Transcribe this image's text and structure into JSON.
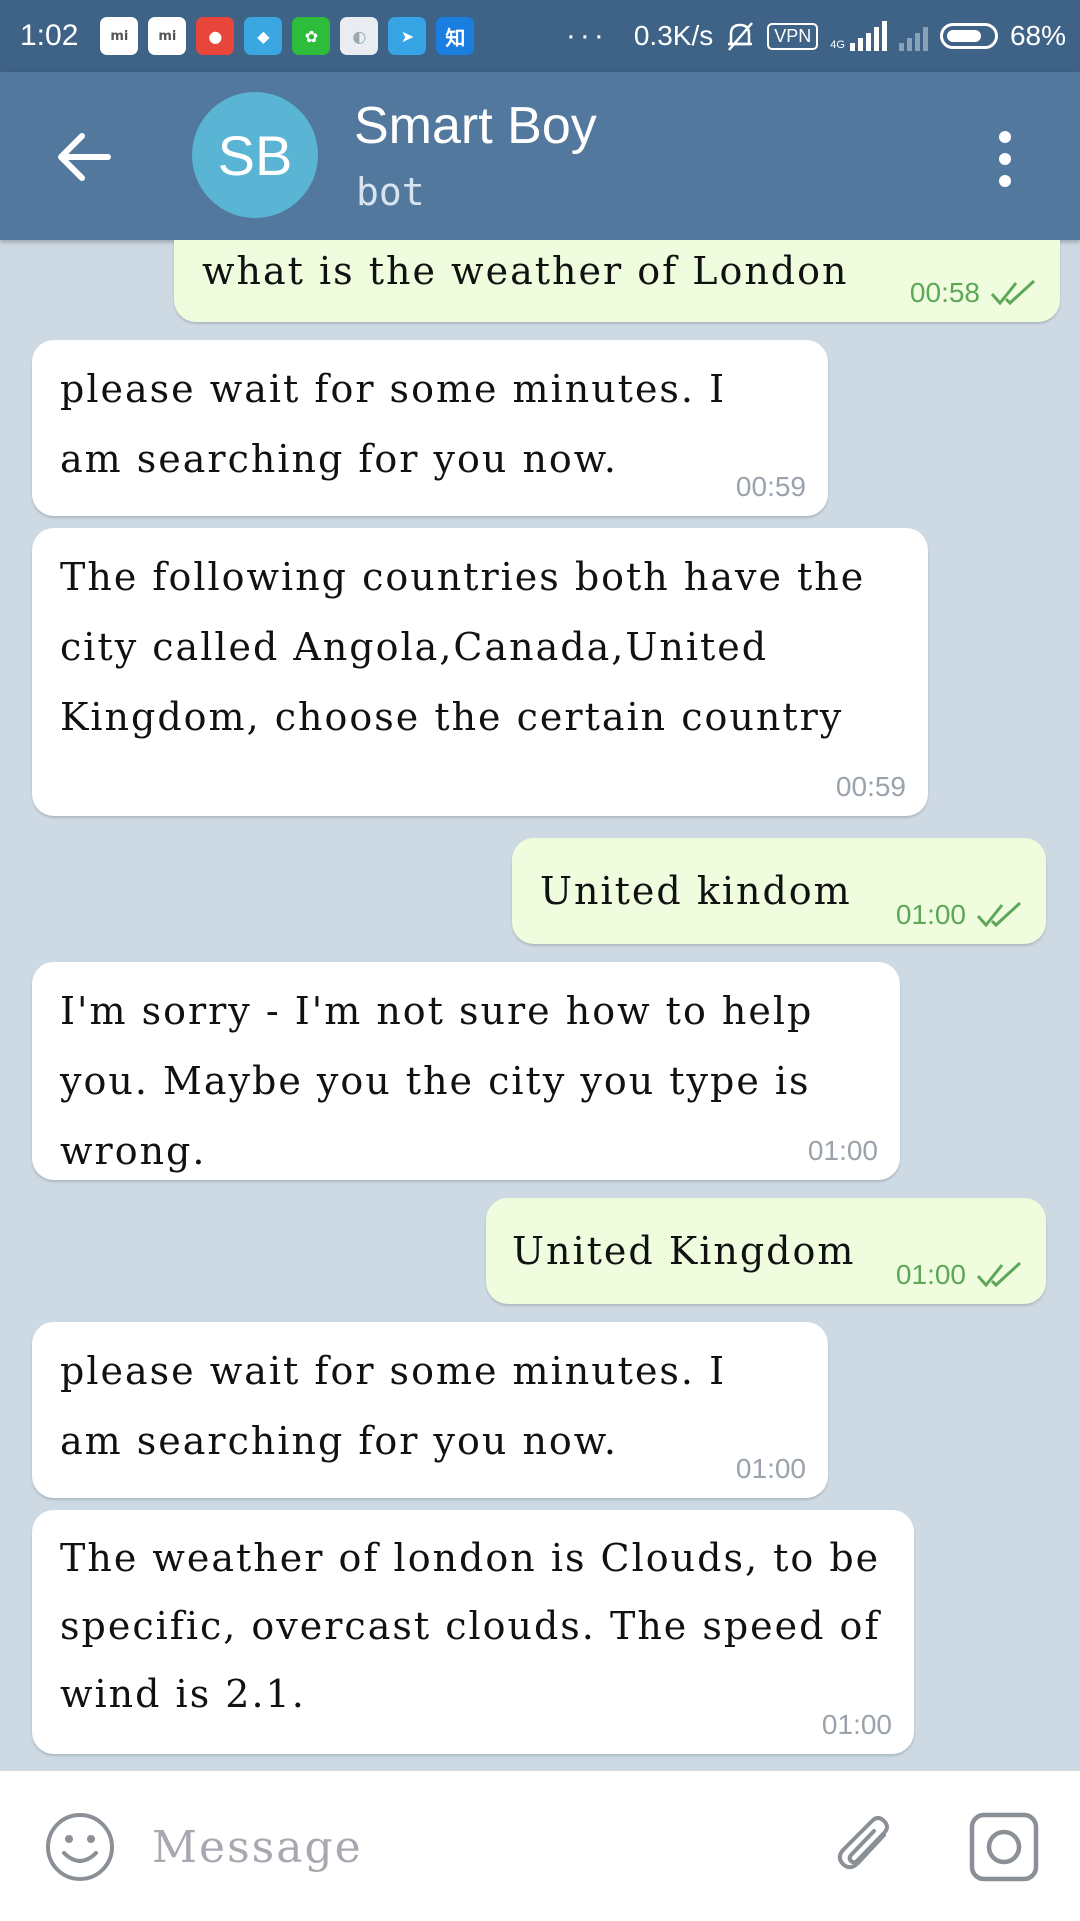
{
  "status_bar": {
    "time": "1:02",
    "notification_icons": [
      {
        "name": "mi-store-icon",
        "color": "#ffffff"
      },
      {
        "name": "mi-store-icon",
        "color": "#ffffff"
      },
      {
        "name": "cat-app-icon",
        "color": "#e8463b"
      },
      {
        "name": "comic-app-icon",
        "color": "#3aa7e0"
      },
      {
        "name": "soccer-app-icon",
        "color": "#2ebd3a"
      },
      {
        "name": "sync-app-icon",
        "color": "#e9edf2"
      },
      {
        "name": "telegram-app-icon",
        "color": "#37a4e6"
      },
      {
        "name": "zhihu-app-icon",
        "color": "#1a7ee0"
      }
    ],
    "more": "···",
    "net_speed": "0.3K/s",
    "vpn": "VPN",
    "network": "4G",
    "battery": "68%"
  },
  "header": {
    "avatar_initials": "SB",
    "title": "Smart Boy",
    "subtitle": "bot"
  },
  "messages": [
    {
      "dir": "out",
      "text": "what is the weather of London",
      "time": "00:58",
      "read": true
    },
    {
      "dir": "in",
      "text": "please wait for some minutes. I am searching for you now.",
      "time": "00:59"
    },
    {
      "dir": "in",
      "text": "The following countries both have the city called Angola,Canada,United Kingdom, choose the certain country",
      "time": "00:59"
    },
    {
      "dir": "out",
      "text": "United kindom",
      "time": "01:00",
      "read": true
    },
    {
      "dir": "in",
      "text": "I'm sorry - I'm not sure how to help you. Maybe you the city you type is wrong.",
      "time": "01:00"
    },
    {
      "dir": "out",
      "text": "United Kingdom",
      "time": "01:00",
      "read": true
    },
    {
      "dir": "in",
      "text": "please wait for some minutes. I am searching for you now.",
      "time": "01:00"
    },
    {
      "dir": "in",
      "text": "The weather of london is Clouds, to be specific, overcast clouds. The speed of wind is 2.1.",
      "time": "01:00"
    }
  ],
  "input": {
    "placeholder": "Message"
  },
  "colors": {
    "header": "#52789e",
    "status_bar": "#3f6386",
    "outgoing_bubble": "#effdde",
    "incoming_bubble": "#ffffff",
    "chat_background": "#cdd9e3",
    "check_marks": "#5ca858"
  }
}
